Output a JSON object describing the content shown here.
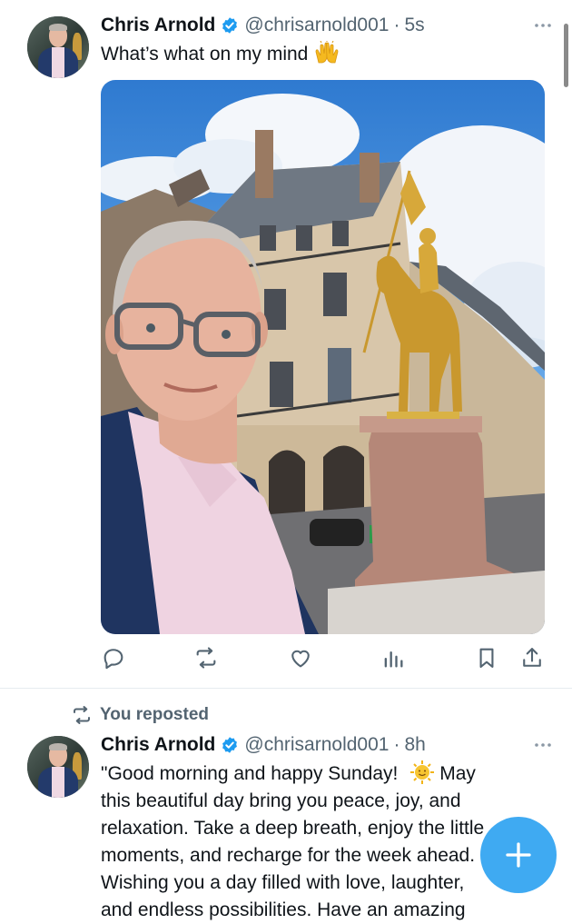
{
  "tweets": [
    {
      "name": "Chris Arnold",
      "handle": "@chrisarnold001",
      "separator": "·",
      "time": "5s",
      "text": "What’s what on my mind",
      "emoji": "raised-hands",
      "photo": "selfie-with-golden-equestrian-statue"
    },
    {
      "repost_label": "You reposted",
      "name": "Chris Arnold",
      "handle": "@chrisarnold001",
      "separator": "·",
      "time": "8h",
      "text_lines": [
        "\"Good morning and happy Sunday!",
        "May",
        "this beautiful day bring you peace, joy, and",
        "relaxation. Take a deep breath, enjoy the little",
        "moments, and recharge for the week ahead.",
        "Wishing you a day filled with love, laughter,",
        "and endless possibilities. Have an amazing"
      ],
      "emoji": "sun-with-face"
    }
  ],
  "actions": [
    "reply-icon",
    "repost-icon",
    "like-icon",
    "views-icon",
    "bookmark-icon",
    "share-icon"
  ],
  "colors": {
    "accent": "#1d9bf0",
    "text": "#0f1419",
    "secondary": "#536471"
  }
}
